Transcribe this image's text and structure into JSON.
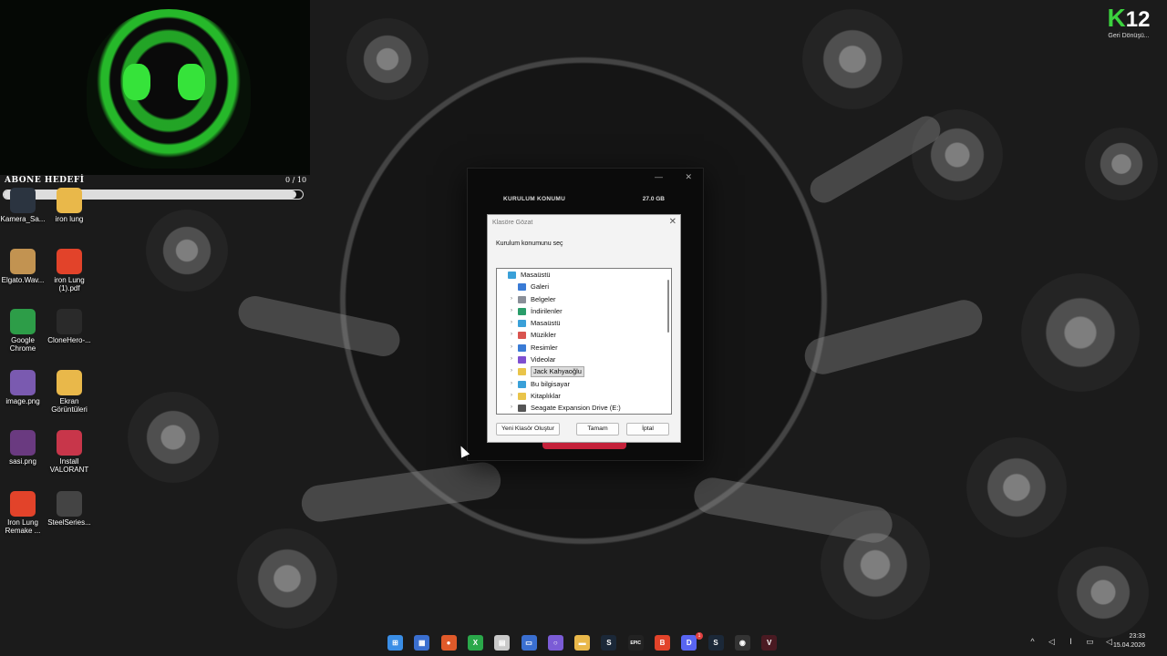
{
  "overlay": {
    "goal_label": "ABONE HEDEFİ",
    "goal_count": "0 / 10",
    "goal_progress": 0.98
  },
  "brand": {
    "logo_k": "K",
    "logo_num": "12",
    "logo_sub": "Geri Dönüşü..."
  },
  "desktop_icons": [
    {
      "label": "Kamera_Sa...",
      "icon": "camera-icon",
      "color": "#2b3440"
    },
    {
      "label": "iron lung",
      "icon": "folder-icon",
      "color": "#e9b84a"
    },
    {
      "label": "Elgato.Wav...",
      "icon": "archive-icon",
      "color": "#c29351"
    },
    {
      "label": "iron Lung (1).pdf",
      "icon": "brave-pdf-icon",
      "color": "#e2432a"
    },
    {
      "label": "Google Chrome",
      "icon": "chrome-icon",
      "color": "#2d9d48"
    },
    {
      "label": "CloneHero-...",
      "icon": "clonehero-icon",
      "color": "#2a2a2a"
    },
    {
      "label": "image.png",
      "icon": "image-icon",
      "color": "#7a5ab0"
    },
    {
      "label": "Ekran Görüntüleri",
      "icon": "folder-icon",
      "color": "#e9b84a"
    },
    {
      "label": "sasi.png",
      "icon": "image-icon",
      "color": "#6a3a80"
    },
    {
      "label": "Install VALORANT",
      "icon": "valorant-icon",
      "color": "#c8364a"
    },
    {
      "label": "Iron Lung Remake ...",
      "icon": "brave-icon",
      "color": "#e2432a"
    },
    {
      "label": "SteelSeries...",
      "icon": "steelseries-icon",
      "color": "#444"
    }
  ],
  "installer": {
    "section_label": "KURULUM KONUMU",
    "size": "27.0 GB",
    "minimize": "—",
    "close": "✕"
  },
  "dialog": {
    "title": "Klasöre Gözat",
    "close": "✕",
    "prompt": "Kurulum konumunu seç",
    "tree": [
      {
        "label": "Masaüstü",
        "icon": "desktop-folder-icon",
        "color": "#3aa0d8",
        "indent": 0,
        "arrow": false,
        "selected": false
      },
      {
        "label": "Galeri",
        "icon": "gallery-icon",
        "color": "#3a7bd5",
        "indent": 1,
        "arrow": false,
        "selected": false
      },
      {
        "label": "Belgeler",
        "icon": "documents-icon",
        "color": "#8a8f98",
        "indent": 1,
        "arrow": true,
        "selected": false
      },
      {
        "label": "İndirilenler",
        "icon": "download-icon",
        "color": "#2a9d6a",
        "indent": 1,
        "arrow": true,
        "selected": false
      },
      {
        "label": "Masaüstü",
        "icon": "desktop-folder-icon",
        "color": "#3aa0d8",
        "indent": 1,
        "arrow": true,
        "selected": false
      },
      {
        "label": "Müzikler",
        "icon": "music-icon",
        "color": "#d9544f",
        "indent": 1,
        "arrow": true,
        "selected": false
      },
      {
        "label": "Resimler",
        "icon": "pictures-icon",
        "color": "#3a7bd5",
        "indent": 1,
        "arrow": true,
        "selected": false
      },
      {
        "label": "Videolar",
        "icon": "videos-icon",
        "color": "#7e4fd0",
        "indent": 1,
        "arrow": true,
        "selected": false
      },
      {
        "label": "Jack Kahyaoğlu",
        "icon": "user-folder-icon",
        "color": "#e9c44a",
        "indent": 1,
        "arrow": true,
        "selected": true
      },
      {
        "label": "Bu bilgisayar",
        "icon": "computer-icon",
        "color": "#3aa0d8",
        "indent": 1,
        "arrow": true,
        "selected": false
      },
      {
        "label": "Kitaplıklar",
        "icon": "libraries-icon",
        "color": "#e9c44a",
        "indent": 1,
        "arrow": true,
        "selected": false
      },
      {
        "label": "Seagate Expansion Drive (E:)",
        "icon": "drive-icon",
        "color": "#555",
        "indent": 1,
        "arrow": true,
        "selected": false
      }
    ],
    "buttons": {
      "new_folder": "Yeni Klasör Oluştur",
      "ok": "Tamam",
      "cancel": "İptal"
    }
  },
  "taskbar": {
    "apps": [
      {
        "name": "start-icon",
        "glyph": "⊞",
        "color": "#3a8ee6"
      },
      {
        "name": "widgets-icon",
        "glyph": "▦",
        "color": "#3a6fd0"
      },
      {
        "name": "app-icon",
        "glyph": "●",
        "color": "#e05a2a"
      },
      {
        "name": "xbox-icon",
        "glyph": "X",
        "color": "#2aa84a"
      },
      {
        "name": "notepad-icon",
        "glyph": "▤",
        "color": "#c9c9c9"
      },
      {
        "name": "app-window-icon",
        "glyph": "▭",
        "color": "#3a6fd0"
      },
      {
        "name": "cortana-icon",
        "glyph": "○",
        "color": "#7b5cd6"
      },
      {
        "name": "file-explorer-icon",
        "glyph": "▬",
        "color": "#e9b84a"
      },
      {
        "name": "steam-icon",
        "glyph": "S",
        "color": "#1b2838"
      },
      {
        "name": "epic-games-icon",
        "glyph": "EPIC",
        "color": "#222"
      },
      {
        "name": "brave-icon",
        "glyph": "B",
        "color": "#e2432a"
      },
      {
        "name": "discord-icon",
        "glyph": "D",
        "color": "#5865f2"
      },
      {
        "name": "steam-icon-2",
        "glyph": "S",
        "color": "#1b2838"
      },
      {
        "name": "obs-icon",
        "glyph": "◉",
        "color": "#333"
      },
      {
        "name": "valorant-icon",
        "glyph": "V",
        "color": "#4a1a22"
      }
    ],
    "discord_badge": "1",
    "tray": [
      {
        "name": "chevron-up-icon",
        "glyph": "^"
      },
      {
        "name": "speaker-icon",
        "glyph": "◁"
      },
      {
        "name": "mic-icon",
        "glyph": "I"
      },
      {
        "name": "network-icon",
        "glyph": "▭"
      },
      {
        "name": "volume-icon",
        "glyph": "◁"
      }
    ],
    "time": "23:33",
    "date": "15.04.2026"
  }
}
